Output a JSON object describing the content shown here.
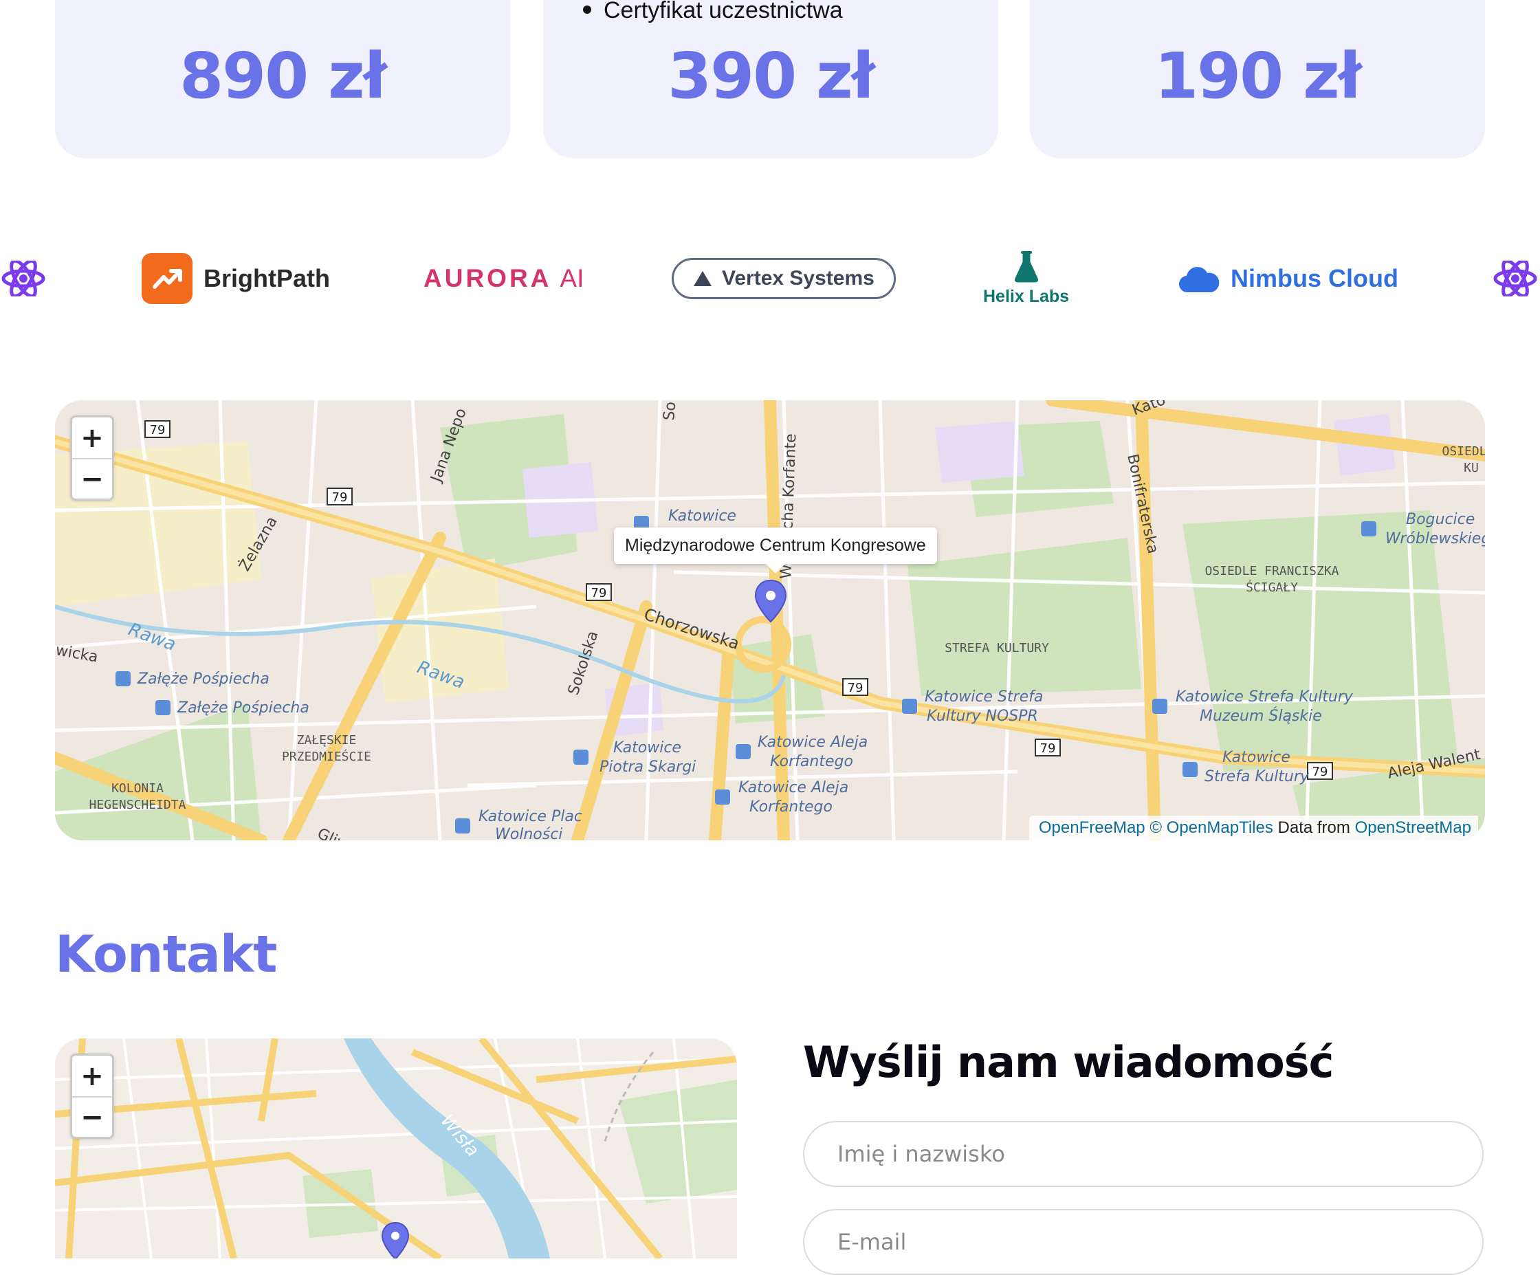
{
  "pricing": {
    "cards": [
      {
        "price": "890 zł"
      },
      {
        "price": "390 zł",
        "feature": "Certyfikat uczestnictwa"
      },
      {
        "price": "190 zł"
      }
    ]
  },
  "sponsors": {
    "items": [
      {
        "name": "BrightPath",
        "color": "#2b2b2b",
        "icon": "trend-up-icon",
        "icon_color": "#f26a1b"
      },
      {
        "name": "AURORA",
        "suffix": "AI",
        "color": "#d6336c"
      },
      {
        "name": "Vertex Systems",
        "color": "#3d4657",
        "icon": "triangle-icon"
      },
      {
        "name": "Helix Labs",
        "color": "#0f766e",
        "icon": "flask-icon"
      },
      {
        "name": "Nimbus Cloud",
        "color": "#2f6fe0",
        "icon": "cloud-icon"
      }
    ],
    "atom_icon_color": "#7c3aed"
  },
  "venue_map": {
    "popup": "Międzynarodowe Centrum Kongresowe",
    "zoom_in": "+",
    "zoom_out": "−",
    "attribution": {
      "openfreemap": "OpenFreeMap",
      "openmaptiles": "© OpenMapTiles",
      "data_from": "Data from",
      "osm": "OpenStreetMap"
    },
    "labels": {
      "road_79": "79",
      "jana_nepo": "Jana Nepo",
      "so": "So",
      "korfante": "Wojciecha Korfante",
      "kato": "Kato",
      "bonifraterska": "Bonifraterska",
      "osiedl": "OSIEDL",
      "kul": "KU",
      "bogucice": "Bogucice",
      "wroblewskiego": "Wróblewskiego",
      "zelazna": "Żelazna",
      "katowice_stop": "Katowice",
      "osiedle_fr": "OSIEDLE FRANCISZKA",
      "scigaly": "ŚCIGAŁY",
      "rawa": "Rawa",
      "chorzowska": "Chorzowska",
      "sokolska": "Sokolska",
      "strefa_kultury": "STREFA KULTURY",
      "wicka": "wicka",
      "zaleze1": "Załęże Pośpiecha",
      "zaleze2": "Załęże Pośpiecha",
      "zaleskie": "ZAŁĘSKIE",
      "przedmiescie": "PRZEDMIEŚCIE",
      "kolonia": "KOLONIA",
      "hegenscheidta": "HEGENSCHEIDTA",
      "gliwicka": "Gliwicka",
      "plac_wolnosci_1": "Katowice Plac",
      "plac_wolnosci_2": "Wolności",
      "piotra_skargi_1": "Katowice",
      "piotra_skargi_2": "Piotra Skargi",
      "aleja_korf_1a": "Katowice Aleja",
      "aleja_korf_1b": "Korfantego",
      "aleja_korf_2a": "Katowice Aleja",
      "aleja_korf_2b": "Korfantego",
      "nospr_1": "Katowice Strefa",
      "nospr_2": "Kultury NOSPR",
      "muzeum_1": "Katowice Strefa Kultury",
      "muzeum_2": "Muzeum Śląskie",
      "strefa_stop_1": "Katowice",
      "strefa_stop_2": "Strefa Kultury",
      "aleja_walenty": "Aleja Walent"
    }
  },
  "contact": {
    "title": "Kontakt",
    "form_title": "Wyślij nam wiadomość",
    "name_placeholder": "Imię i nazwisko",
    "email_placeholder": "E-mail",
    "map": {
      "zoom_in": "+",
      "zoom_out": "−",
      "river": "Wisła"
    }
  },
  "colors": {
    "accent": "#6a72e8",
    "card_bg": "#f0f1fd"
  }
}
